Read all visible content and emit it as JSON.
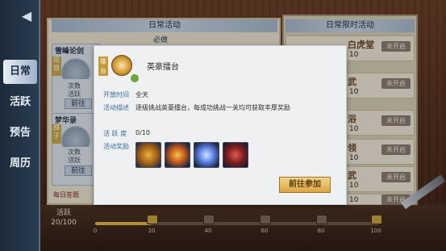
{
  "nav": {
    "back_icon": "back-arrow-icon",
    "items": [
      {
        "label": "日常"
      },
      {
        "label": "活跃"
      },
      {
        "label": "预告"
      },
      {
        "label": "周历"
      }
    ]
  },
  "left_panel": {
    "header": "日常活动",
    "sub": "必做",
    "cards": [
      {
        "title": "雪峰论剑",
        "tag": "项目",
        "stat1": "次数",
        "stat2": "活跃",
        "go": "前往"
      },
      {
        "title": "梦华录",
        "tag": "梯子",
        "stat1": "次数",
        "stat2": "活跃",
        "go": "前往"
      }
    ],
    "bottom_label": "每日答题"
  },
  "right_panel": {
    "header": "日常限时活动",
    "rows": [
      {
        "big": "白虎堂",
        "num": "10",
        "badge": "未开启"
      },
      {
        "big": "武",
        "num": "10",
        "badge": "未开启"
      },
      {
        "big": "浴",
        "num": "10",
        "badge": "未开启"
      },
      {
        "big": "领",
        "num": "10",
        "badge": "未开启"
      },
      {
        "big": "武",
        "num": "10",
        "badge": "未开启"
      },
      {
        "big": "",
        "num": "10",
        "badge": "未开启"
      }
    ]
  },
  "progress": {
    "label": "活跃",
    "value_text": "20/100",
    "current": 20,
    "max": 100,
    "ticks": [
      "0",
      "20",
      "40",
      "60",
      "80",
      "100"
    ]
  },
  "modal": {
    "tag": "擂台",
    "title": "英豪擂台",
    "open_time_label": "开放时间",
    "open_time_value": "全天",
    "desc_label": "活动描述",
    "desc_value": "逐级挑战英豪擂台，每成功挑战一关均可获取丰厚奖励",
    "activity_label": "活 跃 度",
    "activity_value": "0/10",
    "reward_label": "活动奖励",
    "rewards": [
      "reward-item-1",
      "reward-item-2",
      "reward-item-3",
      "reward-item-4"
    ],
    "join_button": "前往参加"
  }
}
